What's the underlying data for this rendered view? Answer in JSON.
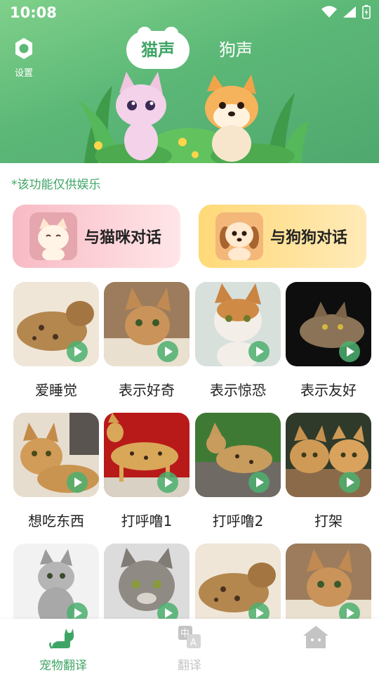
{
  "status": {
    "time": "10:08"
  },
  "header": {
    "settings_label": "设置",
    "tabs": [
      {
        "label": "猫声",
        "active": true
      },
      {
        "label": "狗声",
        "active": false
      }
    ]
  },
  "notice": "*该功能仅供娱乐",
  "talk_buttons": {
    "cat": "与猫咪对话",
    "dog": "与狗狗对话"
  },
  "sounds": [
    {
      "label": "爱睡觉"
    },
    {
      "label": "表示好奇"
    },
    {
      "label": "表示惊恐"
    },
    {
      "label": "表示友好"
    },
    {
      "label": "想吃东西"
    },
    {
      "label": "打呼噜1"
    },
    {
      "label": "打呼噜2"
    },
    {
      "label": "打架"
    },
    {
      "label": ""
    },
    {
      "label": ""
    },
    {
      "label": ""
    },
    {
      "label": ""
    }
  ],
  "bottom_nav": [
    {
      "label": "宠物翻译",
      "icon": "cat-icon",
      "active": true
    },
    {
      "label": "翻译",
      "icon": "translate-icon",
      "active": false
    },
    {
      "label": "",
      "icon": "home-icon",
      "active": false
    }
  ],
  "colors": {
    "accent": "#3fa566",
    "header_gradient_start": "#7fd08a",
    "header_gradient_end": "#4fa86e",
    "cat_button": "#f8bac4",
    "dog_button": "#ffd978"
  }
}
